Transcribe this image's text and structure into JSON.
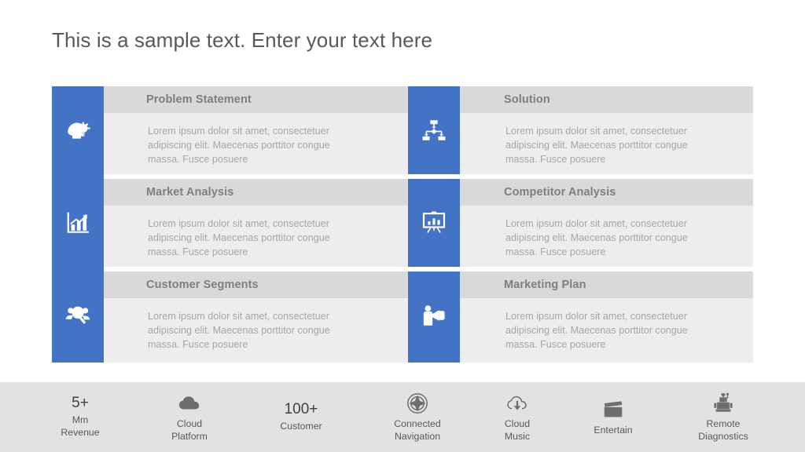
{
  "slide": {
    "title": "This is a sample text. Enter your text here",
    "accent_color": "#4472C4",
    "header_band_color": "#D9D9D9",
    "body_band_color": "#EDEDED",
    "strip_color": "#E2E2E2"
  },
  "matrix": {
    "left_column": [
      {
        "icon": "head-lightbulb-icon",
        "heading": "Problem Statement",
        "body": "Lorem ipsum dolor sit amet, consectetuer\nadipiscing elit.  Maecenas porttitor congue\nmassa. Fusce posuere"
      },
      {
        "icon": "bar-chart-growth-icon",
        "heading": "Market Analysis",
        "body": "Lorem ipsum dolor sit amet, consectetuer\nadipiscing elit.  Maecenas porttitor congue\nmassa. Fusce posuere"
      },
      {
        "icon": "people-search-icon",
        "heading": "Customer Segments",
        "body": "Lorem ipsum dolor sit amet, consectetuer\nadipiscing elit.  Maecenas porttitor congue\nmassa. Fusce posuere"
      }
    ],
    "right_column": [
      {
        "icon": "hierarchy-flowchart-icon",
        "heading": "Solution",
        "body": "Lorem ipsum dolor sit amet, consectetuer\nadipiscing elit.  Maecenas porttitor congue\nmassa. Fusce posuere"
      },
      {
        "icon": "presentation-chart-icon",
        "heading": "Competitor Analysis",
        "body": "Lorem ipsum dolor sit amet, consectetuer\nadipiscing elit.  Maecenas porttitor congue\nmassa. Fusce posuere"
      },
      {
        "icon": "megaphone-person-icon",
        "heading": "Marketing Plan",
        "body": "Lorem ipsum dolor sit amet, consectetuer\nadipiscing elit.  Maecenas porttitor congue\nmassa. Fusce posuere"
      }
    ]
  },
  "bottom_strip": {
    "items": [
      {
        "type": "number",
        "value": "5+",
        "label": "Mm\nRevenue",
        "icon": null
      },
      {
        "type": "icon",
        "value": null,
        "label": "Cloud\nPlatform",
        "icon": "cloud-icon"
      },
      {
        "type": "number",
        "value": "100+",
        "label": "Customer",
        "icon": null
      },
      {
        "type": "icon",
        "value": null,
        "label": "Connected\nNavigation",
        "icon": "compass-icon"
      },
      {
        "type": "icon",
        "value": null,
        "label": "Cloud\nMusic",
        "icon": "cloud-download-icon"
      },
      {
        "type": "icon",
        "value": null,
        "label": "Entertain",
        "icon": "clapperboard-icon"
      },
      {
        "type": "icon",
        "value": null,
        "label": "Remote\nDiagnostics",
        "icon": "robot-icon"
      }
    ]
  }
}
